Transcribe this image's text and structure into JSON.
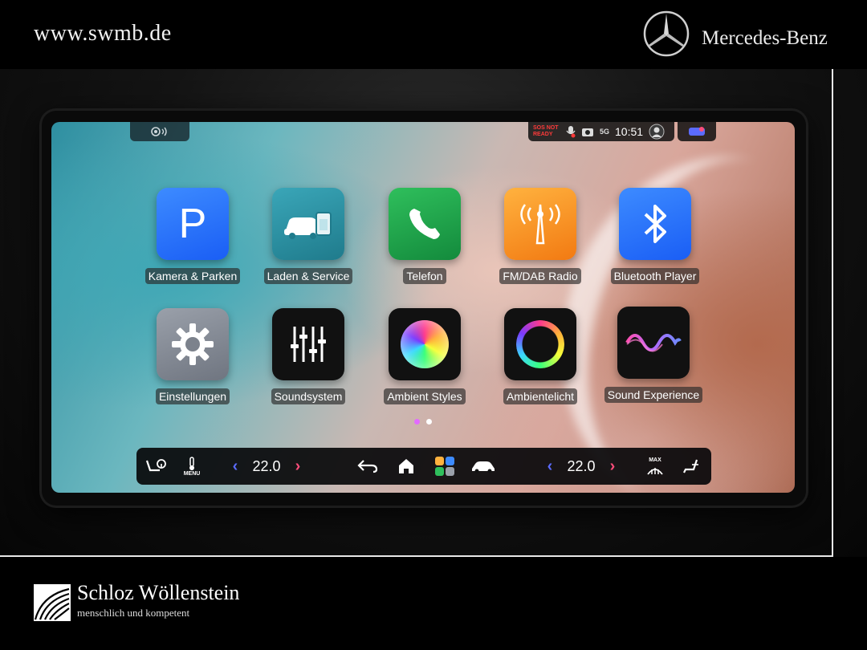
{
  "header": {
    "url": "www.swmb.de",
    "brand": "Mercedes-Benz"
  },
  "status_bar": {
    "sos": "SOS NOT READY",
    "network": "5G",
    "time": "10:51"
  },
  "apps": [
    {
      "label": "Kamera & Parken",
      "icon": "parking-icon",
      "color": "#1f6fff"
    },
    {
      "label": "Laden & Service",
      "icon": "car-service-icon",
      "color": "#2f8fa3"
    },
    {
      "label": "Telefon",
      "icon": "phone-icon",
      "color": "#1e9e4a"
    },
    {
      "label": "FM/DAB Radio",
      "icon": "radio-tower-icon",
      "color": "#ff8f1f"
    },
    {
      "label": "Bluetooth Player",
      "icon": "bluetooth-icon",
      "color": "#1f6fff"
    },
    {
      "label": "Einstellungen",
      "icon": "gear-icon",
      "color": "#8a8f9a"
    },
    {
      "label": "Soundsystem",
      "icon": "equalizer-icon",
      "color": "#111111"
    },
    {
      "label": "Ambient Styles",
      "icon": "color-sphere-icon",
      "color": "#111111"
    },
    {
      "label": "Ambientelicht",
      "icon": "color-ring-icon",
      "color": "#111111"
    },
    {
      "label": "Sound Experience",
      "icon": "sound-wave-icon",
      "color": "#111111"
    }
  ],
  "pages": {
    "count": 2,
    "active": 1
  },
  "dock": {
    "left_temp": "22.0",
    "right_temp": "22.0",
    "menu_label": "MENU",
    "max_label": "MAX"
  },
  "footer": {
    "dealer_name": "Schloz Wöllenstein",
    "dealer_tagline": "menschlich und kompetent"
  }
}
